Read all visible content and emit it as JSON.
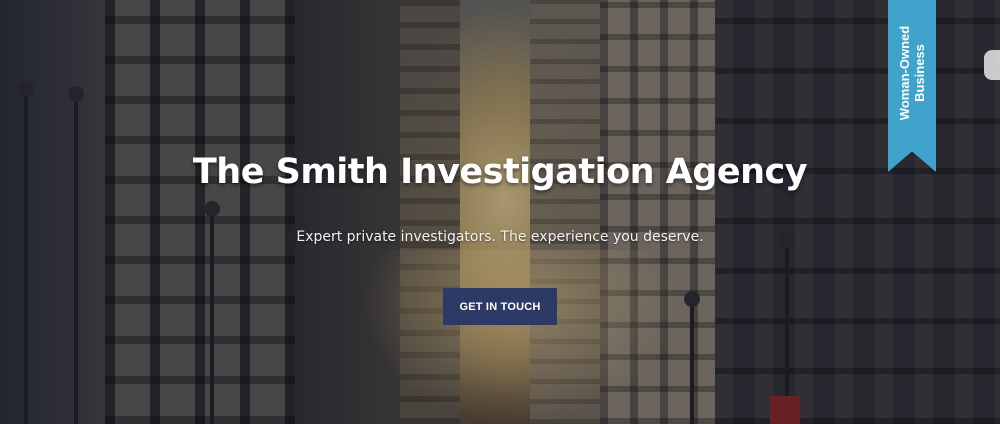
{
  "hero": {
    "title": "The Smith Investigation Agency",
    "subtitle": "Expert private investigators. The experience you deserve.",
    "cta_label": "GET IN TOUCH"
  },
  "badge": {
    "line1": "Woman-Owned",
    "line2": "Business"
  },
  "colors": {
    "cta_background": "#2d3a66",
    "badge_background": "#3fa3cc",
    "text": "#ffffff"
  }
}
